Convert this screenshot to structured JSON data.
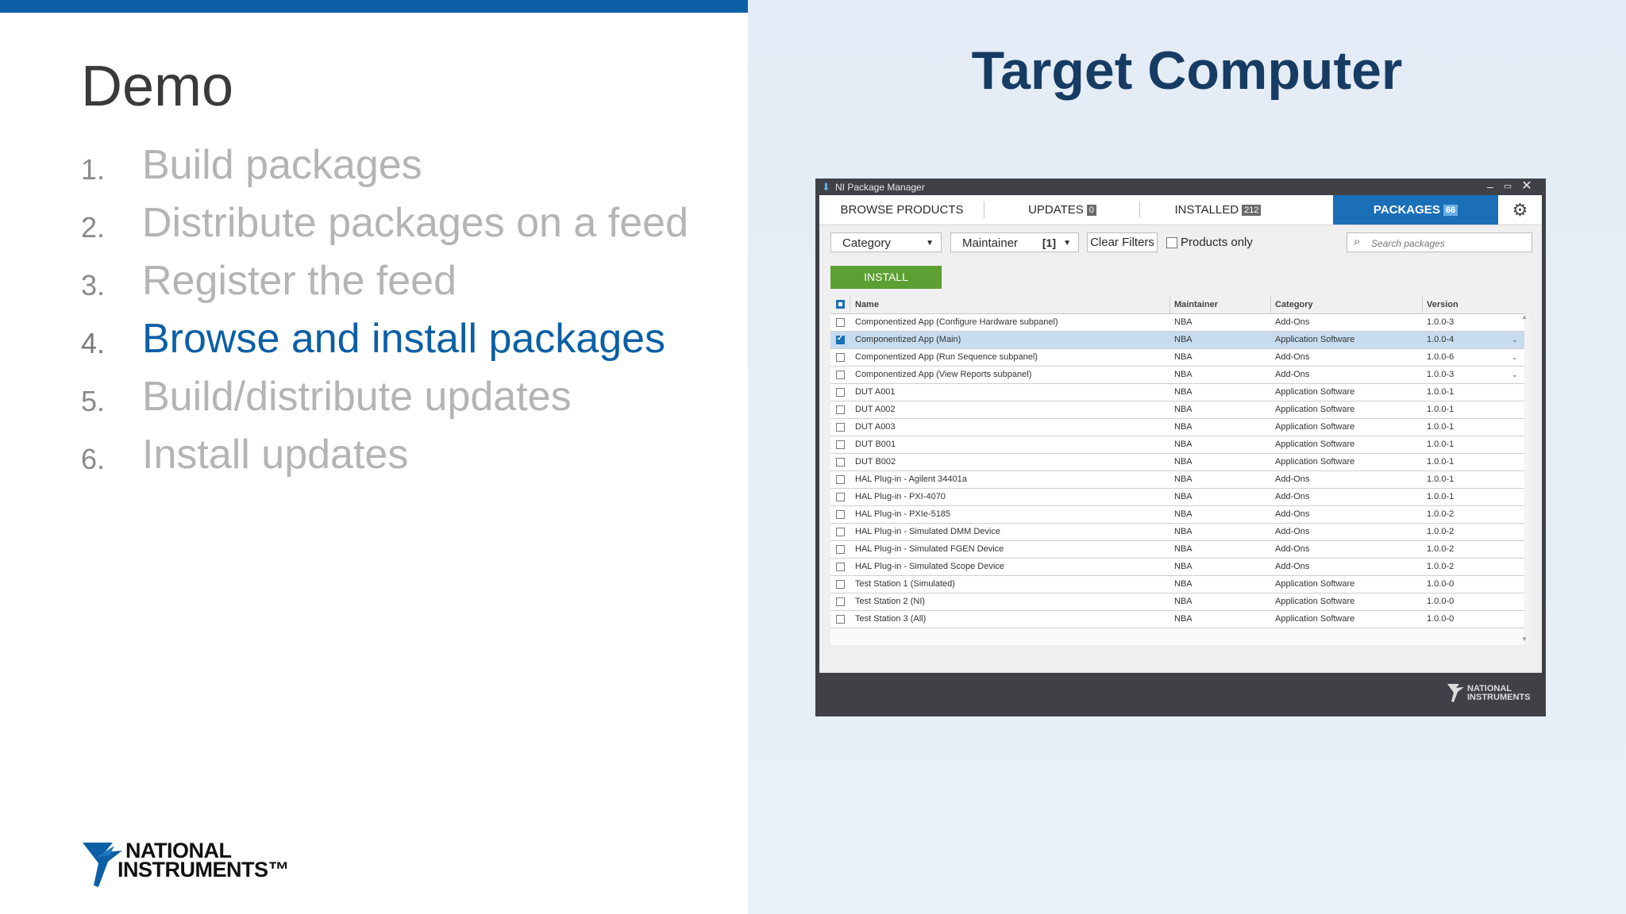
{
  "slide": {
    "title": "Demo",
    "agenda": [
      {
        "num": "1.",
        "text": "Build packages"
      },
      {
        "num": "2.",
        "text": "Distribute packages on a feed"
      },
      {
        "num": "3.",
        "text": "Register the feed"
      },
      {
        "num": "4.",
        "text": "Browse and install packages"
      },
      {
        "num": "5.",
        "text": "Build/distribute updates"
      },
      {
        "num": "6.",
        "text": "Install updates"
      }
    ],
    "active_item": "4.",
    "logo": {
      "line1": "NATIONAL",
      "line2": "INSTRUMENTS™"
    },
    "right_title": "Target Computer",
    "accent_color": "#0b5fa5",
    "title_color": "#173c64"
  },
  "package_manager": {
    "window_title": "NI Package Manager",
    "tabs": [
      {
        "label": "BROWSE PRODUCTS",
        "badge": ""
      },
      {
        "label": "UPDATES",
        "badge": "0"
      },
      {
        "label": "INSTALLED",
        "badge": "212"
      },
      {
        "label": "PACKAGES",
        "badge": "66"
      }
    ],
    "active_tab": "PACKAGES",
    "filters": {
      "category": "Category",
      "maintainer": "Maintainer",
      "maintainer_count": "[1]",
      "clear_filters": "Clear Filters",
      "products_only": "Products only",
      "search_placeholder": "Search packages"
    },
    "install_label": "INSTALL",
    "install_color": "#5c9f33",
    "columns": [
      "Name",
      "Maintainer",
      "Category",
      "Version"
    ],
    "rows": [
      {
        "name": "Componentized App (Configure Hardware subpanel)",
        "maintainer": "NBA",
        "category": "Add-Ons",
        "version": "1.0.0-3",
        "checked": false,
        "more": ""
      },
      {
        "name": "Componentized App (Main)",
        "maintainer": "NBA",
        "category": "Application Software",
        "version": "1.0.0-4",
        "checked": true,
        "more": "⌄"
      },
      {
        "name": "Componentized App (Run Sequence subpanel)",
        "maintainer": "NBA",
        "category": "Add-Ons",
        "version": "1.0.0-6",
        "checked": false,
        "more": "⌄"
      },
      {
        "name": "Componentized App (View Reports subpanel)",
        "maintainer": "NBA",
        "category": "Add-Ons",
        "version": "1.0.0-3",
        "checked": false,
        "more": "⌄"
      },
      {
        "name": "DUT A001",
        "maintainer": "NBA",
        "category": "Application Software",
        "version": "1.0.0-1",
        "checked": false,
        "more": ""
      },
      {
        "name": "DUT A002",
        "maintainer": "NBA",
        "category": "Application Software",
        "version": "1.0.0-1",
        "checked": false,
        "more": ""
      },
      {
        "name": "DUT A003",
        "maintainer": "NBA",
        "category": "Application Software",
        "version": "1.0.0-1",
        "checked": false,
        "more": ""
      },
      {
        "name": "DUT B001",
        "maintainer": "NBA",
        "category": "Application Software",
        "version": "1.0.0-1",
        "checked": false,
        "more": ""
      },
      {
        "name": "DUT B002",
        "maintainer": "NBA",
        "category": "Application Software",
        "version": "1.0.0-1",
        "checked": false,
        "more": ""
      },
      {
        "name": "HAL Plug-in - Agilent 34401a",
        "maintainer": "NBA",
        "category": "Add-Ons",
        "version": "1.0.0-1",
        "checked": false,
        "more": ""
      },
      {
        "name": "HAL Plug-in - PXI-4070",
        "maintainer": "NBA",
        "category": "Add-Ons",
        "version": "1.0.0-1",
        "checked": false,
        "more": ""
      },
      {
        "name": "HAL Plug-in - PXIe-5185",
        "maintainer": "NBA",
        "category": "Add-Ons",
        "version": "1.0.0-2",
        "checked": false,
        "more": ""
      },
      {
        "name": "HAL Plug-in - Simulated DMM Device",
        "maintainer": "NBA",
        "category": "Add-Ons",
        "version": "1.0.0-2",
        "checked": false,
        "more": ""
      },
      {
        "name": "HAL Plug-in - Simulated FGEN Device",
        "maintainer": "NBA",
        "category": "Add-Ons",
        "version": "1.0.0-2",
        "checked": false,
        "more": ""
      },
      {
        "name": "HAL Plug-in - Simulated Scope Device",
        "maintainer": "NBA",
        "category": "Add-Ons",
        "version": "1.0.0-2",
        "checked": false,
        "more": ""
      },
      {
        "name": "Test Station 1 (Simulated)",
        "maintainer": "NBA",
        "category": "Application Software",
        "version": "1.0.0-0",
        "checked": false,
        "more": ""
      },
      {
        "name": "Test Station 2 (NI)",
        "maintainer": "NBA",
        "category": "Application Software",
        "version": "1.0.0-0",
        "checked": false,
        "more": ""
      },
      {
        "name": "Test Station 3 (All)",
        "maintainer": "NBA",
        "category": "Application Software",
        "version": "1.0.0-0",
        "checked": false,
        "more": ""
      }
    ],
    "footer_logo": {
      "line1": "NATIONAL",
      "line2": "INSTRUMENTS"
    }
  }
}
